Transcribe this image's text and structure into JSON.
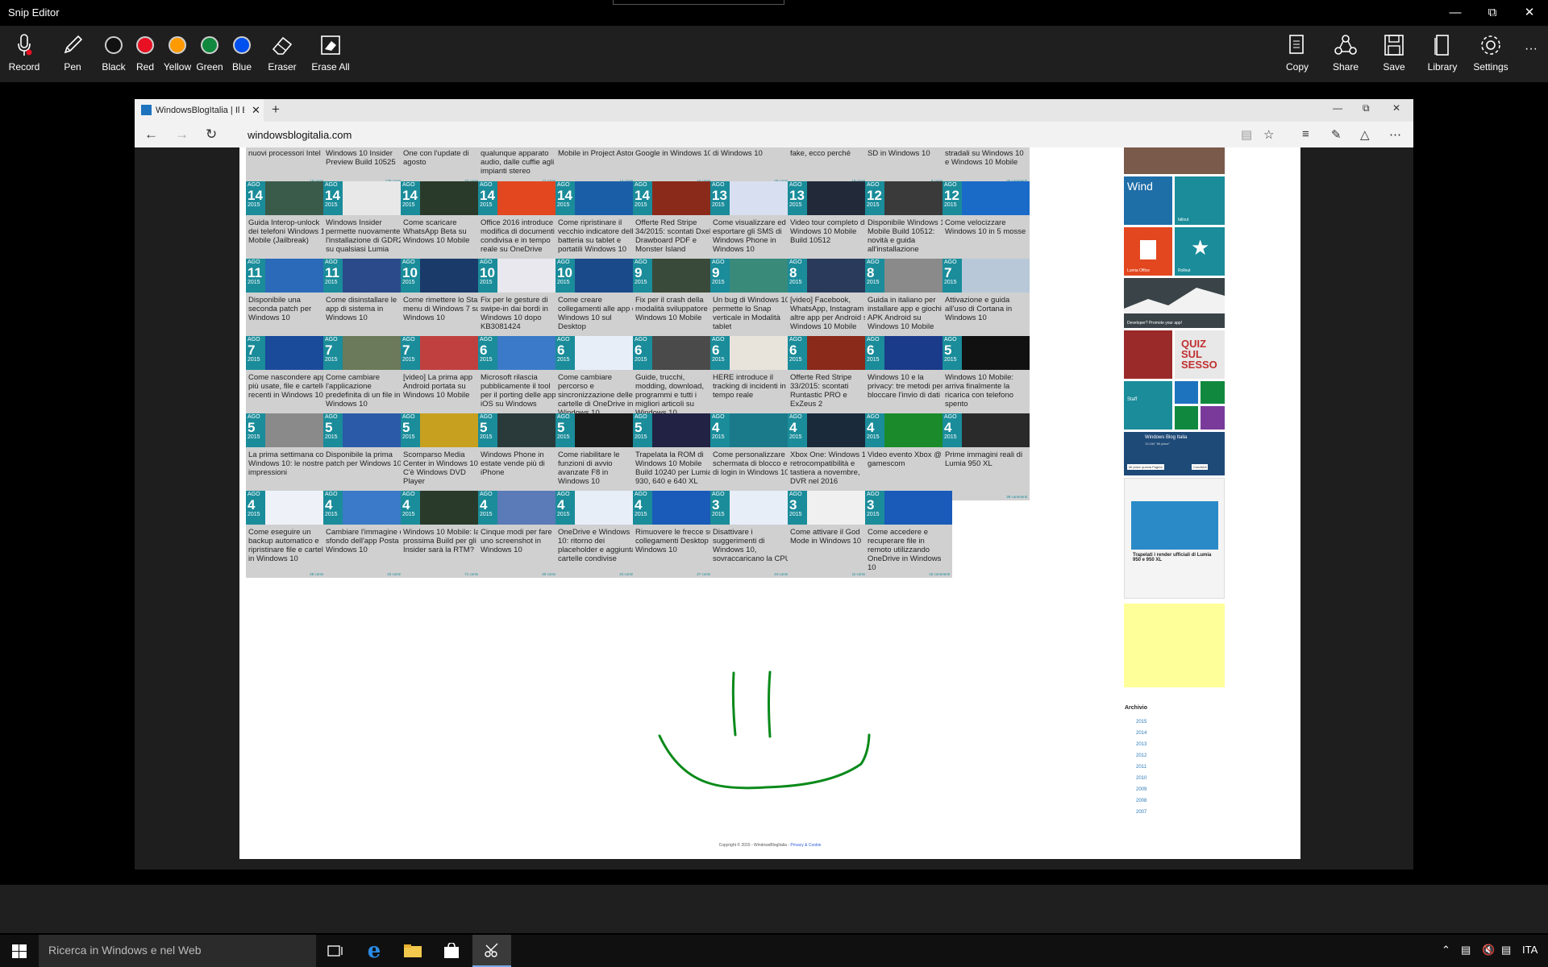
{
  "window": {
    "title": "Snip Editor"
  },
  "toolbar": {
    "record": "Record",
    "pen": "Pen",
    "black": "Black",
    "red": "Red",
    "yellow": "Yellow",
    "green": "Green",
    "blue": "Blue",
    "eraser": "Eraser",
    "erase_all": "Erase All",
    "copy": "Copy",
    "share": "Share",
    "save": "Save",
    "library": "Library",
    "settings": "Settings",
    "more": "···"
  },
  "colors": {
    "black": "#111111",
    "red": "#e81123",
    "yellow": "#ff9b00",
    "green": "#10893e",
    "blue": "#0050ef",
    "ink": "#0a8a1a",
    "tile_accent": "#1a8c9a"
  },
  "browser": {
    "tab_title": "WindowsBlogItalia | Il Bl",
    "url": "windowsblogitalia.com"
  },
  "top_row": [
    {
      "title": "nuovi processori Intel",
      "comments": "19 commenti"
    },
    {
      "title": "Windows 10 Insider Preview Build 10525",
      "comments": "176 commenti"
    },
    {
      "title": "One con l'update di agosto",
      "comments": "22 commenti"
    },
    {
      "title": "qualunque apparato audio, dalle cuffie agli impianti stereo",
      "comments": "12 commenti"
    },
    {
      "title": "Mobile in Project Astoria",
      "comments": "14 commenti"
    },
    {
      "title": "Google in Windows 10",
      "comments": "44 commenti"
    },
    {
      "title": "di Windows 10",
      "comments": "26 commenti"
    },
    {
      "title": "fake, ecco perché",
      "comments": "19 commenti"
    },
    {
      "title": "SD in Windows 10",
      "comments": "8 commenti"
    },
    {
      "title": "stradali su Windows 10 e Windows 10 Mobile",
      "comments": "25 commenti"
    }
  ],
  "rows": [
    [
      {
        "m": "AGO",
        "d": "14",
        "y": "2015",
        "title": "Guida Interop-unlock dei telefoni Windows 10 Mobile (Jailbreak)",
        "comments": "46 commenti",
        "c": "#3a5a4a"
      },
      {
        "m": "AGO",
        "d": "14",
        "y": "2015",
        "title": "Windows Insider permette nuovamente l'installazione di GDR2 su qualsiasi Lumia",
        "comments": "9 commenti",
        "c": "#e8e8e8"
      },
      {
        "m": "AGO",
        "d": "14",
        "y": "2015",
        "title": "Come scaricare WhatsApp Beta su Windows 10 Mobile",
        "comments": "106 commenti",
        "c": "#2a3a2a"
      },
      {
        "m": "AGO",
        "d": "14",
        "y": "2015",
        "title": "Office 2016 introduce la modifica di documenti condivisa e in tempo reale su OneDrive",
        "comments": "8 commenti",
        "c": "#e2471f"
      },
      {
        "m": "AGO",
        "d": "14",
        "y": "2015",
        "title": "Come ripristinare il vecchio indicatore della batteria su tablet e portatili Windows 10",
        "comments": "10 commenti",
        "c": "#1a5ea8"
      },
      {
        "m": "AGO",
        "d": "14",
        "y": "2015",
        "title": "Offerte Red Stripe 34/2015: scontati Dxelp, Drawboard PDF e Monster Island",
        "comments": "15 commenti",
        "c": "#8a2a1a"
      },
      {
        "m": "AGO",
        "d": "13",
        "y": "2015",
        "title": "Come visualizzare ed esportare gli SMS di Windows Phone in Windows 10",
        "comments": "21 commenti",
        "c": "#d8dff0"
      },
      {
        "m": "AGO",
        "d": "13",
        "y": "2015",
        "title": "Video tour completo di Windows 10 Mobile Build 10512",
        "comments": "29 commenti",
        "c": "#222a3a"
      },
      {
        "m": "AGO",
        "d": "12",
        "y": "2015",
        "title": "Disponibile Windows 10 Mobile Build 10512: novità e guida all'installazione",
        "comments": "344 commenti",
        "c": "#3a3a3a"
      },
      {
        "m": "AGO",
        "d": "12",
        "y": "2015",
        "title": "Come velocizzare Windows 10 in 5 mosse",
        "comments": "34 commenti",
        "c": "#1a6ac8"
      }
    ],
    [
      {
        "m": "AGO",
        "d": "11",
        "y": "2015",
        "title": "Disponibile una seconda patch per Windows 10",
        "comments": "47 commenti",
        "c": "#2a6ab8"
      },
      {
        "m": "AGO",
        "d": "11",
        "y": "2015",
        "title": "Come disinstallare le app di sistema in Windows 10",
        "comments": "79 commenti",
        "c": "#2a4a8a"
      },
      {
        "m": "AGO",
        "d": "10",
        "y": "2015",
        "title": "Come rimettere lo Start menu di Windows 7 su Windows 10",
        "comments": "43 commenti",
        "c": "#1a3a6a"
      },
      {
        "m": "AGO",
        "d": "10",
        "y": "2015",
        "title": "Fix per le gesture di swipe-in dai bordi in Windows 10 dopo KB3081424",
        "comments": "42 commenti",
        "c": "#e8e8ee"
      },
      {
        "m": "AGO",
        "d": "10",
        "y": "2015",
        "title": "Come creare collegamenti alle app di Windows 10 sul Desktop",
        "comments": "22 commenti",
        "c": "#1a4a8a"
      },
      {
        "m": "AGO",
        "d": "9",
        "y": "2015",
        "title": "Fix per il crash della modalità sviluppatore di Windows 10 Mobile",
        "comments": "25 commenti",
        "c": "#3a4a3a"
      },
      {
        "m": "AGO",
        "d": "9",
        "y": "2015",
        "title": "Un bug di Windows 10 permette lo Snap verticale in Modalità tablet",
        "comments": "8 commenti",
        "c": "#3a8a7a"
      },
      {
        "m": "AGO",
        "d": "8",
        "y": "2015",
        "title": "[video] Facebook, WhatsApp, Instagram e altre app per Android su Windows 10 Mobile",
        "comments": "49 commenti",
        "c": "#2a3a5a"
      },
      {
        "m": "AGO",
        "d": "8",
        "y": "2015",
        "title": "Guida in italiano per installare app e giochi APK Android su Windows 10 Mobile",
        "comments": "344 commenti",
        "c": "#8a8a8a"
      },
      {
        "m": "AGO",
        "d": "7",
        "y": "2015",
        "title": "Attivazione e guida all'uso di Cortana in Windows 10",
        "comments": "39 commenti",
        "c": "#b8c8d8"
      }
    ],
    [
      {
        "m": "AGO",
        "d": "7",
        "y": "2015",
        "title": "Come nascondere app più usate, file e cartelle recenti in Windows 10",
        "comments": "16 commenti",
        "c": "#1a4a9a"
      },
      {
        "m": "AGO",
        "d": "7",
        "y": "2015",
        "title": "Come cambiare l'applicazione predefinita di un file in Windows 10",
        "comments": "38 commenti",
        "c": "#6a7a5a"
      },
      {
        "m": "AGO",
        "d": "7",
        "y": "2015",
        "title": "[video] La prima app Android portata su Windows 10 Mobile",
        "comments": "23 commenti",
        "c": "#c04040"
      },
      {
        "m": "AGO",
        "d": "6",
        "y": "2015",
        "title": "Microsoft rilascia pubblicamente il tool per il porting delle app iOS su Windows",
        "comments": "29 commenti",
        "c": "#3a7ac8"
      },
      {
        "m": "AGO",
        "d": "6",
        "y": "2015",
        "title": "Come cambiare percorso e sincronizzazione delle cartelle di OneDrive in Windows 10",
        "comments": "16 commenti",
        "c": "#e8eef8"
      },
      {
        "m": "AGO",
        "d": "6",
        "y": "2015",
        "title": "Guide, trucchi, modding, download, programmi e tutti i migliori articoli su Windows 10",
        "comments": "7 commenti",
        "c": "#4a4a4a"
      },
      {
        "m": "AGO",
        "d": "6",
        "y": "2015",
        "title": "HERE introduce il tracking di incidenti in tempo reale",
        "comments": "26 commenti",
        "c": "#e8e4dc"
      },
      {
        "m": "AGO",
        "d": "6",
        "y": "2015",
        "title": "Offerte Red Stripe 33/2015: scontati Runtastic PRO e ExZeus 2",
        "comments": "12 commenti",
        "c": "#8a2a1a"
      },
      {
        "m": "AGO",
        "d": "6",
        "y": "2015",
        "title": "Windows 10 e la privacy: tre metodi per bloccare l'invio di dati",
        "comments": "90 commenti",
        "c": "#1a3a8a"
      },
      {
        "m": "AGO",
        "d": "5",
        "y": "2015",
        "title": "Windows 10 Mobile: arriva finalmente la ricarica con telefono spento",
        "comments": "43 commenti",
        "c": "#111111"
      }
    ],
    [
      {
        "m": "AGO",
        "d": "5",
        "y": "2015",
        "title": "La prima settimana con Windows 10: le nostre impressioni",
        "comments": "9 commenti",
        "c": "#8a8a8a"
      },
      {
        "m": "AGO",
        "d": "5",
        "y": "2015",
        "title": "Disponibile la prima patch per Windows 10",
        "comments": "21 commenti",
        "c": "#2a5aa8"
      },
      {
        "m": "AGO",
        "d": "5",
        "y": "2015",
        "title": "Scomparso Media Center in Windows 10? C'è Windows DVD Player",
        "comments": "14 commenti",
        "c": "#c8a020"
      },
      {
        "m": "AGO",
        "d": "5",
        "y": "2015",
        "title": "Windows Phone in estate vende più di iPhone",
        "comments": "51 commenti",
        "c": "#2a3a3a"
      },
      {
        "m": "AGO",
        "d": "5",
        "y": "2015",
        "title": "Come riabilitare le funzioni di avvio avanzate F8 in Windows 10",
        "comments": "16 commenti",
        "c": "#1a1a1a"
      },
      {
        "m": "AGO",
        "d": "5",
        "y": "2015",
        "title": "Trapelata la ROM di Windows 10 Mobile Build 10240 per Lumia 930, 640 e 640 XL",
        "comments": "38 commenti",
        "c": "#222244"
      },
      {
        "m": "AGO",
        "d": "4",
        "y": "2015",
        "title": "Come personalizzare la schermata di blocco e di login in Windows 10",
        "comments": "21 commenti",
        "c": "#1a7a8a"
      },
      {
        "m": "AGO",
        "d": "4",
        "y": "2015",
        "title": "Xbox One: Windows 10, retrocompatibilità e tastiera a novembre, DVR nel 2016",
        "comments": "2 commenti",
        "c": "#1a2a3a"
      },
      {
        "m": "AGO",
        "d": "4",
        "y": "2015",
        "title": "Video evento Xbox @ gamescom",
        "comments": "5 commenti",
        "c": "#1a8a2a"
      },
      {
        "m": "AGO",
        "d": "4",
        "y": "2015",
        "title": "Prime immagini reali di Lumia 950 XL",
        "comments": "39 commenti",
        "c": "#2a2a2a"
      }
    ],
    [
      {
        "m": "AGO",
        "d": "4",
        "y": "2015",
        "title": "Come eseguire un backup automatico e ripristinare file e cartelle in Windows 10",
        "comments": "28 commenti",
        "c": "#eef2f8"
      },
      {
        "m": "AGO",
        "d": "4",
        "y": "2015",
        "title": "Cambiare l'immagine di sfondo dell'app Posta di Windows 10",
        "comments": "42 commenti",
        "c": "#3a7ac8"
      },
      {
        "m": "AGO",
        "d": "4",
        "y": "2015",
        "title": "Windows 10 Mobile: la prossima Build per gli Insider sarà la RTM?",
        "comments": "71 commenti",
        "c": "#2a3a2a"
      },
      {
        "m": "AGO",
        "d": "4",
        "y": "2015",
        "title": "Cinque modi per fare uno screenshot in Windows 10",
        "comments": "30 commenti",
        "c": "#5a7ab8"
      },
      {
        "m": "AGO",
        "d": "4",
        "y": "2015",
        "title": "OneDrive e Windows 10: ritorno dei placeholder e aggiunta cartelle condivise",
        "comments": "34 commenti",
        "c": "#e8eef8"
      },
      {
        "m": "AGO",
        "d": "4",
        "y": "2015",
        "title": "Rimuovere le frecce sui collegamenti Desktop in Windows 10",
        "comments": "27 commenti",
        "c": "#1a5ab8"
      },
      {
        "m": "AGO",
        "d": "3",
        "y": "2015",
        "title": "Disattivare i suggerimenti di Windows 10, sovraccaricano la CPU",
        "comments": "24 commenti",
        "c": "#e8eef8"
      },
      {
        "m": "AGO",
        "d": "3",
        "y": "2015",
        "title": "Come attivare il God Mode in Windows 10",
        "comments": "11 commenti",
        "c": "#f0f0f0"
      },
      {
        "m": "AGO",
        "d": "3",
        "y": "2015",
        "title": "Come accedere e recuperare file in remoto utilizzando OneDrive in Windows 10",
        "comments": "15 commenti",
        "c": "#1a5ab8"
      }
    ]
  ],
  "sidebar": {
    "tiles": {
      "office": "Lumia Office",
      "fallout": "fallout",
      "rollout": "Rollout",
      "developer": "Developer? Promote your app!",
      "staff": "Staff",
      "wind": "Wind"
    },
    "facebook": {
      "page": "Windows Blog Italia",
      "likes": "13.184 \"Mi piace\"",
      "like_btn": "Mi piace questa Pagina",
      "share_btn": "Condividi",
      "post_title": "Trapelati i render ufficiali di Lumia 950 e 950 XL"
    },
    "archive_title": "Archivio",
    "archive_years": [
      "2015",
      "2014",
      "2013",
      "2012",
      "2011",
      "2010",
      "2009",
      "2008",
      "2007"
    ]
  },
  "footer": {
    "copyright": "Copyright © 2015 - WindowsBlogItalia - ",
    "privacy": "Privacy & Cookie"
  },
  "taskbar": {
    "search_placeholder": "Ricerca in Windows e nel Web",
    "language": "ITA"
  }
}
